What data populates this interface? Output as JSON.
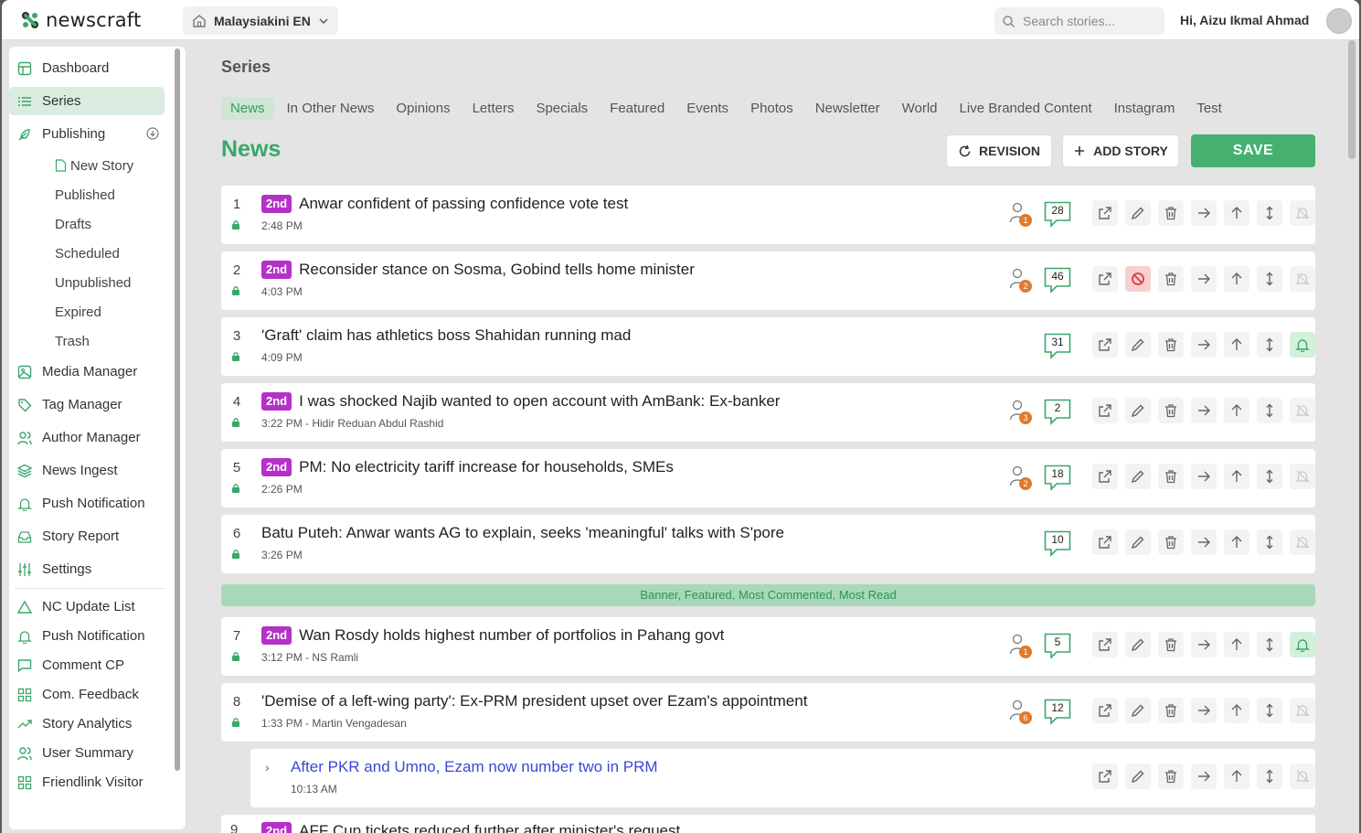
{
  "app": {
    "name": "newscraft",
    "site": "Malaysiakini EN",
    "search_placeholder": "Search stories...",
    "greeting": "Hi, Aizu Ikmal Ahmad"
  },
  "colors": {
    "accent": "#3aa76a",
    "badge": "#b530c9",
    "author_count": "#e07a2c"
  },
  "sidebar": {
    "items": [
      {
        "label": "Dashboard",
        "icon": "dashboard-icon"
      },
      {
        "label": "Series",
        "icon": "list-icon"
      },
      {
        "label": "Publishing",
        "icon": "feather-icon"
      }
    ],
    "publishing_sub": [
      "New Story",
      "Published",
      "Drafts",
      "Scheduled",
      "Unpublished",
      "Expired",
      "Trash"
    ],
    "items2": [
      {
        "label": "Media Manager",
        "icon": "image-icon"
      },
      {
        "label": "Tag Manager",
        "icon": "tag-icon"
      },
      {
        "label": "Author Manager",
        "icon": "users-icon"
      },
      {
        "label": "News Ingest",
        "icon": "layers-icon"
      },
      {
        "label": "Push Notification",
        "icon": "bell-icon"
      },
      {
        "label": "Story Report",
        "icon": "inbox-icon"
      },
      {
        "label": "Settings",
        "icon": "sliders-icon"
      }
    ],
    "items3": [
      {
        "label": "NC Update List",
        "icon": "triangle-icon"
      },
      {
        "label": "Push Notification",
        "icon": "bell-icon"
      },
      {
        "label": "Comment CP",
        "icon": "comment-icon"
      },
      {
        "label": "Com. Feedback",
        "icon": "grid-icon"
      },
      {
        "label": "Story Analytics",
        "icon": "trend-icon"
      },
      {
        "label": "User Summary",
        "icon": "users-icon"
      },
      {
        "label": "Friendlink Visitor",
        "icon": "grid-icon"
      }
    ]
  },
  "main": {
    "page_title": "Series",
    "tabs": [
      "News",
      "In Other News",
      "Opinions",
      "Letters",
      "Specials",
      "Featured",
      "Events",
      "Photos",
      "Newsletter",
      "World",
      "Live Branded Content",
      "Instagram",
      "Test"
    ],
    "section_title": "News",
    "revision_label": "REVISION",
    "add_story_label": "ADD STORY",
    "save_label": "SAVE",
    "banner": "Banner, Featured, Most Commented, Most Read"
  },
  "stories": [
    {
      "num": "1",
      "badge": "2nd",
      "title": "Anwar confident of passing confidence vote test",
      "meta": "2:48 PM",
      "authors": "1",
      "comments": "28",
      "blocked": false,
      "bell": false
    },
    {
      "num": "2",
      "badge": "2nd",
      "title": "Reconsider stance on Sosma, Gobind tells home minister",
      "meta": "4:03 PM",
      "authors": "2",
      "comments": "46",
      "blocked": true,
      "bell": false
    },
    {
      "num": "3",
      "badge": "",
      "title": "'Graft' claim has athletics boss Shahidan running mad",
      "meta": "4:09 PM",
      "authors": "",
      "comments": "31",
      "blocked": false,
      "bell": true
    },
    {
      "num": "4",
      "badge": "2nd",
      "title": "I was shocked Najib wanted to open account with AmBank: Ex-banker",
      "meta": "3:22 PM - Hidir Reduan Abdul Rashid",
      "authors": "3",
      "comments": "2",
      "blocked": false,
      "bell": false
    },
    {
      "num": "5",
      "badge": "2nd",
      "title": "PM: No electricity tariff increase for households, SMEs",
      "meta": "2:26 PM",
      "authors": "2",
      "comments": "18",
      "blocked": false,
      "bell": false
    },
    {
      "num": "6",
      "badge": "",
      "title": "Batu Puteh: Anwar wants AG to explain, seeks 'meaningful' talks with S'pore",
      "meta": "3:26 PM",
      "authors": "",
      "comments": "10",
      "blocked": false,
      "bell": false
    },
    {
      "num": "7",
      "badge": "2nd",
      "title": "Wan Rosdy holds highest number of portfolios in Pahang govt",
      "meta": "3:12 PM - NS Ramli",
      "authors": "1",
      "comments": "5",
      "blocked": false,
      "bell": true
    },
    {
      "num": "8",
      "badge": "",
      "title": "'Demise of a left-wing party': Ex-PRM president upset over Ezam's appointment",
      "meta": "1:33 PM - Martin Vengadesan",
      "authors": "6",
      "comments": "12",
      "blocked": false,
      "bell": false
    }
  ],
  "substory": {
    "title": "After PKR and Umno, Ezam now number two in PRM",
    "meta": "10:13 AM"
  },
  "partial_story": {
    "num": "9",
    "badge": "2nd",
    "title": "AFF Cup tickets reduced further after minister's request"
  }
}
